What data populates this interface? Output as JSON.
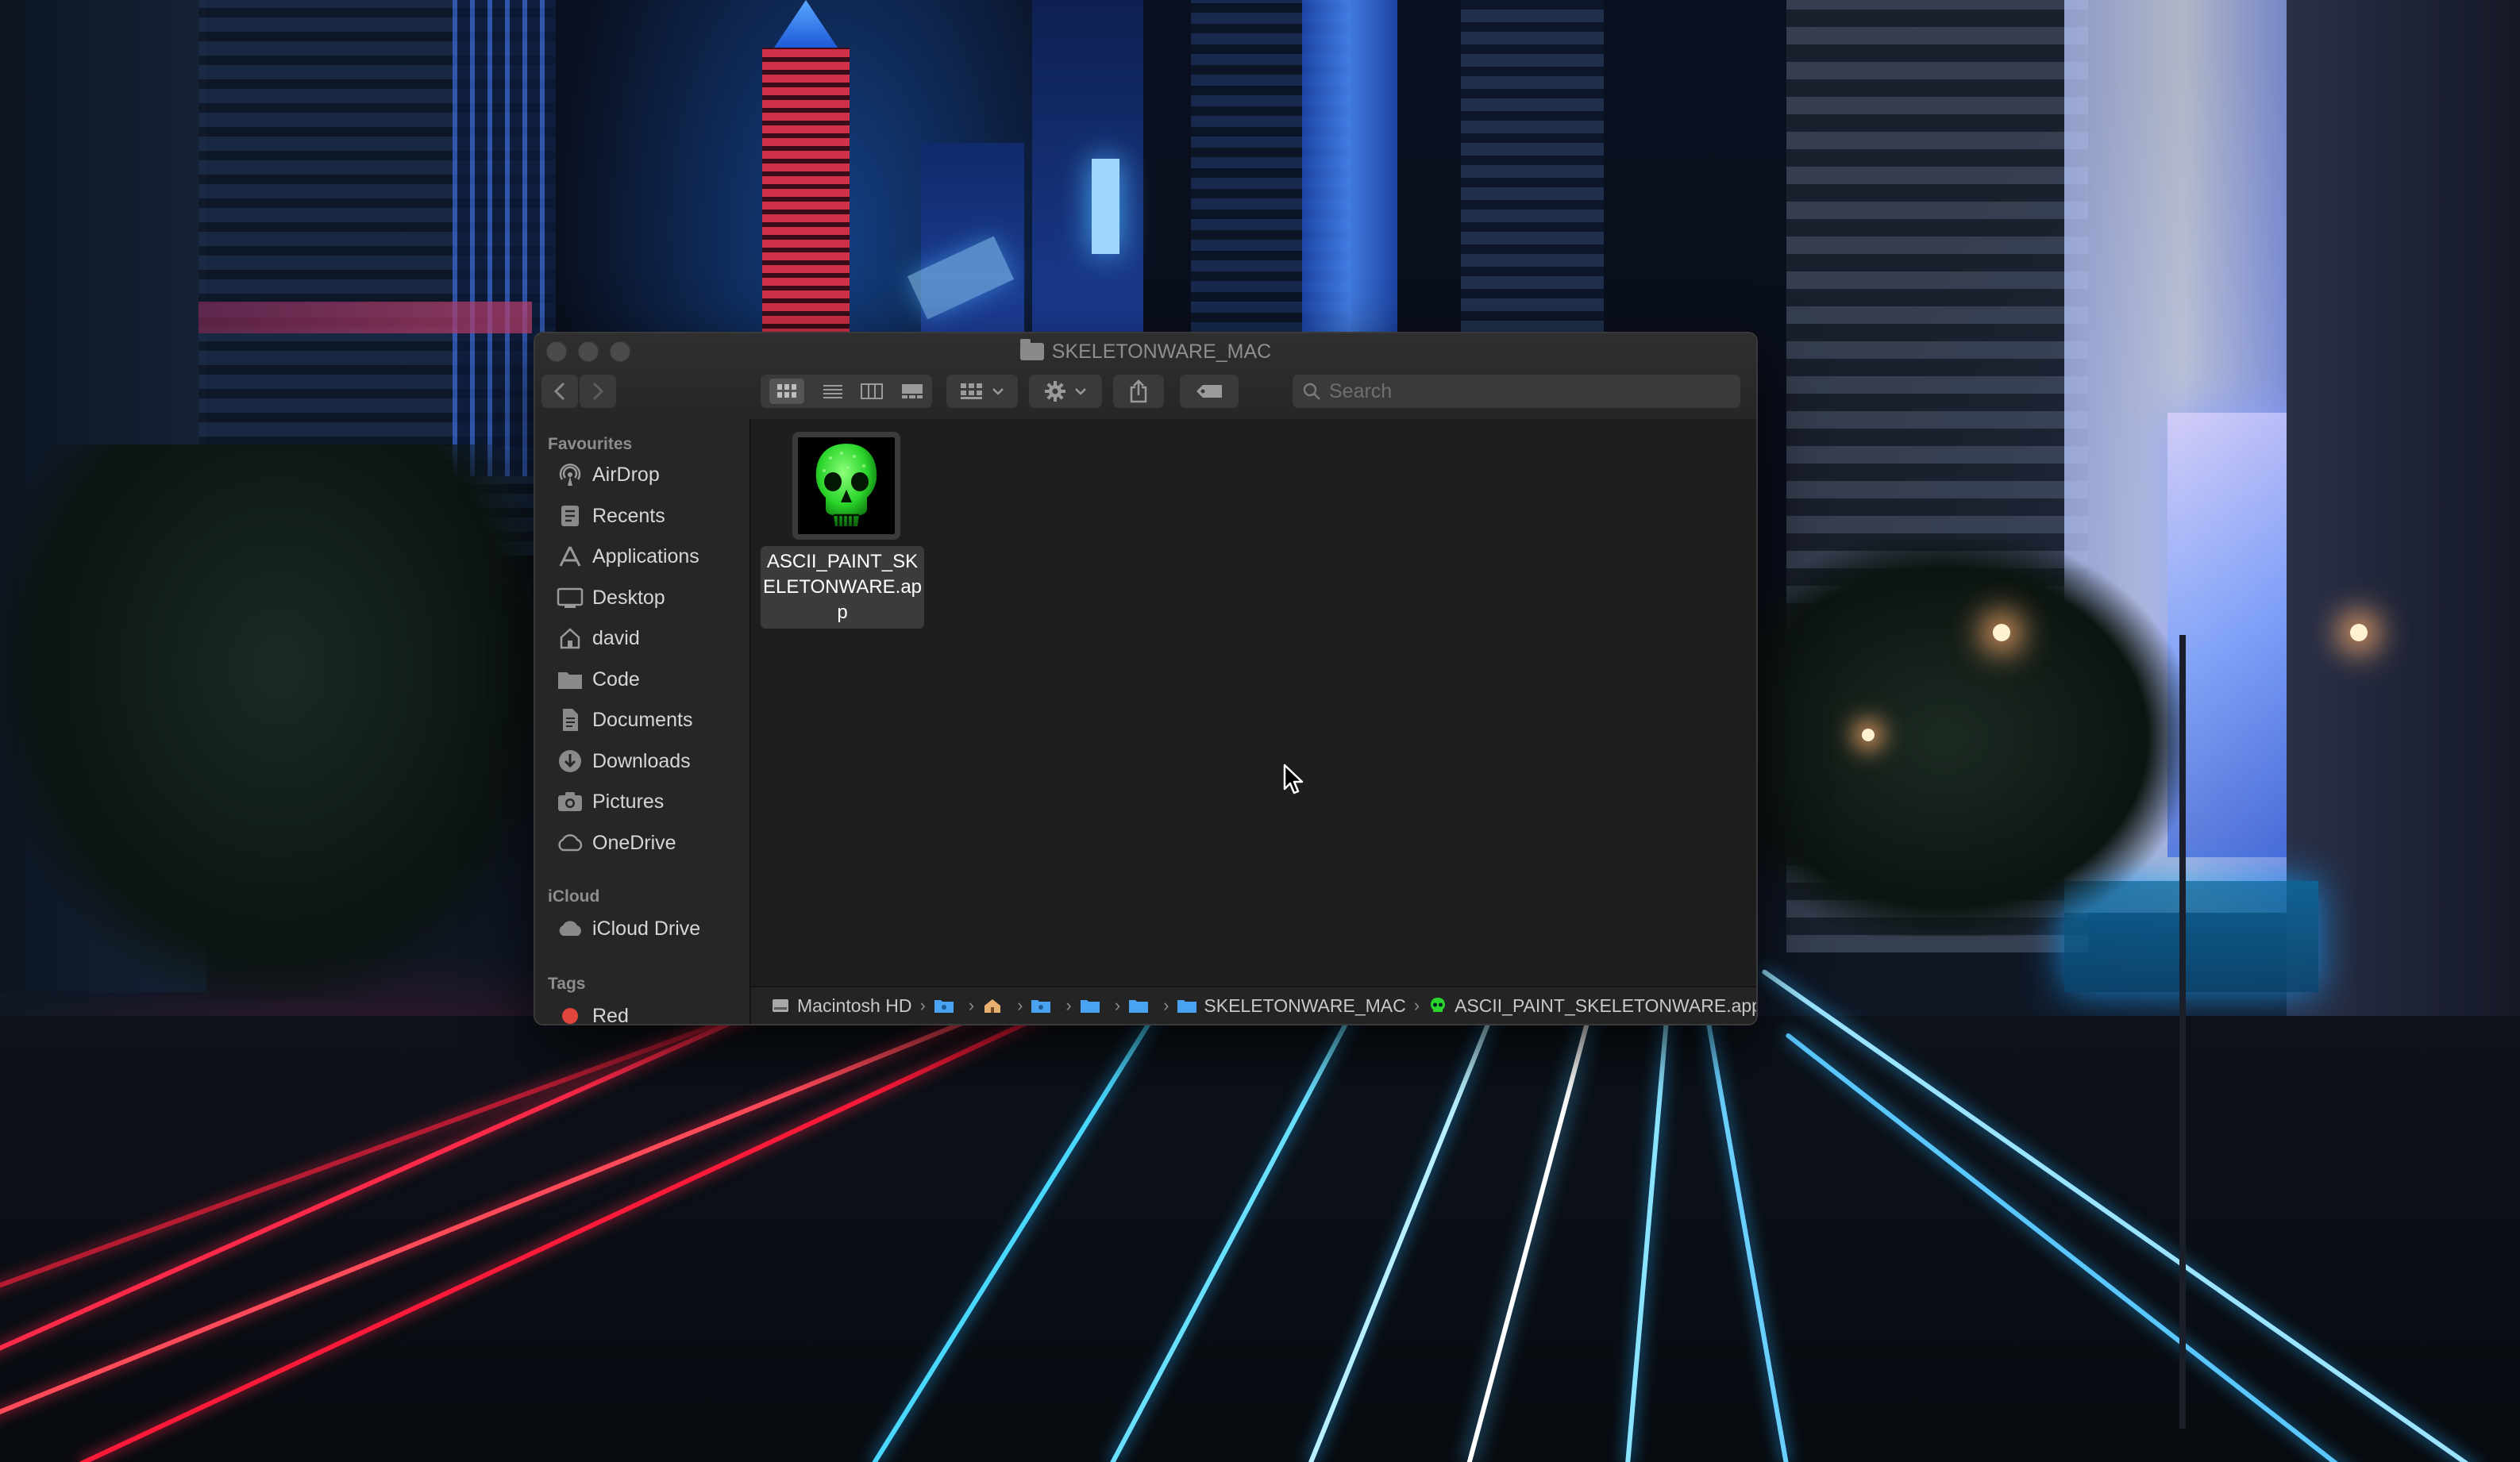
{
  "window": {
    "title": "SKELETONWARE_MAC",
    "search_placeholder": "Search"
  },
  "toolbar": {
    "icons": [
      "chevron-left-icon",
      "chevron-right-icon",
      "icon-view-icon",
      "list-view-icon",
      "column-view-icon",
      "gallery-view-icon",
      "group-by-icon",
      "action-gear-icon",
      "share-icon",
      "tag-icon"
    ]
  },
  "sidebar": {
    "favourites_heading": "Favourites",
    "favourites": [
      {
        "label": "AirDrop",
        "icon": "airdrop-icon"
      },
      {
        "label": "Recents",
        "icon": "recents-icon"
      },
      {
        "label": "Applications",
        "icon": "applications-icon"
      },
      {
        "label": "Desktop",
        "icon": "desktop-icon"
      },
      {
        "label": "david",
        "icon": "home-icon"
      },
      {
        "label": "Code",
        "icon": "folder-icon"
      },
      {
        "label": "Documents",
        "icon": "documents-icon"
      },
      {
        "label": "Downloads",
        "icon": "downloads-icon"
      },
      {
        "label": "Pictures",
        "icon": "pictures-icon"
      },
      {
        "label": "OneDrive",
        "icon": "cloud-icon"
      }
    ],
    "icloud_heading": "iCloud",
    "icloud": [
      {
        "label": "iCloud Drive",
        "icon": "icloud-icon"
      }
    ],
    "tags_heading": "Tags",
    "tags": [
      {
        "label": "Red",
        "color": "#e0443c"
      }
    ]
  },
  "files": [
    {
      "name": "ASCII_PAINT_SKELETONWARE.app",
      "icon": "green-skull-app-icon",
      "selected": true
    }
  ],
  "pathbar": {
    "items": [
      {
        "label": "Macintosh HD",
        "icon": "hard-drive-icon"
      },
      {
        "label": "",
        "icon": "folder-icon"
      },
      {
        "label": "",
        "icon": "home-icon"
      },
      {
        "label": "",
        "icon": "folder-icon"
      },
      {
        "label": "",
        "icon": "folder-icon"
      },
      {
        "label": "",
        "icon": "folder-icon"
      },
      {
        "label": "SKELETONWARE_MAC",
        "icon": "folder-icon"
      },
      {
        "label": "ASCII_PAINT_SKELETONWARE.app",
        "icon": "green-skull-app-icon"
      }
    ]
  },
  "colors": {
    "window_bg": "#1e1e1e",
    "sidebar_bg": "#262626",
    "accent_folder": "#4aa3f0",
    "skull_green": "#2ad42a"
  }
}
